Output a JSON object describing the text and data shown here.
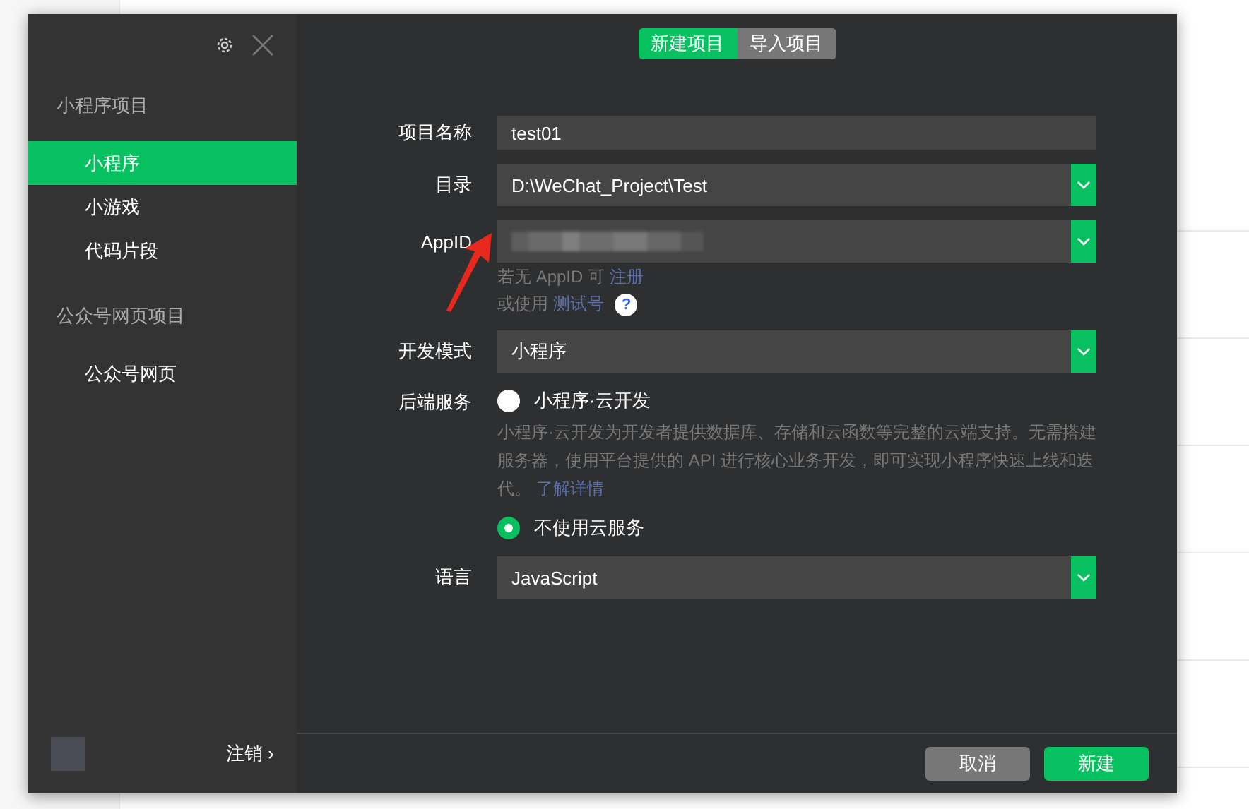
{
  "sidebar": {
    "groups": [
      {
        "title": "小程序项目",
        "items": [
          {
            "label": "小程序",
            "selected": true
          },
          {
            "label": "小游戏",
            "selected": false
          },
          {
            "label": "代码片段",
            "selected": false
          }
        ]
      },
      {
        "title": "公众号网页项目",
        "items": [
          {
            "label": "公众号网页",
            "selected": false
          }
        ]
      }
    ],
    "logout": {
      "label": "注销",
      "arrow": "›"
    }
  },
  "tabs": [
    {
      "label": "新建项目",
      "selected": true
    },
    {
      "label": "导入项目",
      "selected": false
    }
  ],
  "form": {
    "project_name": {
      "label": "项目名称",
      "value": "test01"
    },
    "directory": {
      "label": "目录",
      "value": "D:\\WeChat_Project\\Test"
    },
    "appid": {
      "label": "AppID",
      "hint_1": "若无 AppID 可",
      "hint_1_link": "注册",
      "hint_2": "或使用",
      "hint_2_link": "测试号",
      "help": "?"
    },
    "dev_mode": {
      "label": "开发模式",
      "value": "小程序"
    },
    "backend": {
      "label": "后端服务",
      "options": [
        {
          "label": "小程序·云开发",
          "selected": false,
          "description": "小程序·云开发为开发者提供数据库、存储和云函数等完整的云端支持。无需搭建服务器，使用平台提供的 API 进行核心业务开发，即可实现小程序快速上线和迭代。",
          "link": "了解详情"
        },
        {
          "label": "不使用云服务",
          "selected": true
        }
      ]
    },
    "language": {
      "label": "语言",
      "value": "JavaScript"
    }
  },
  "buttons": [
    {
      "label": "取消",
      "kind": "secondary"
    },
    {
      "label": "新建",
      "kind": "primary"
    }
  ]
}
